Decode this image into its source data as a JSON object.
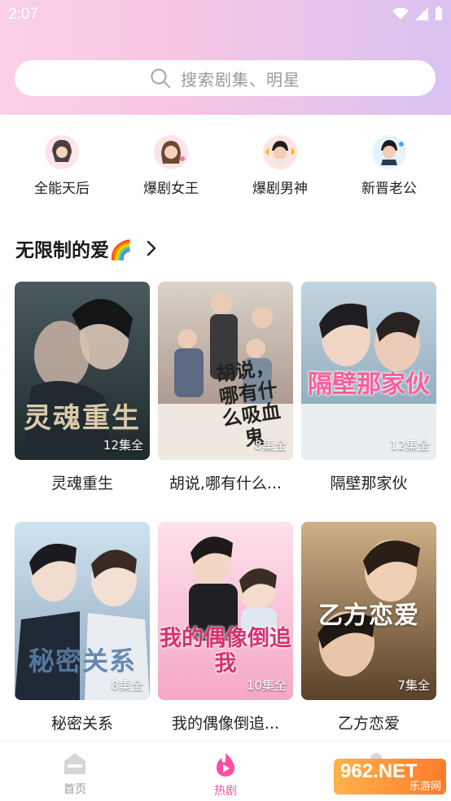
{
  "status": {
    "time": "2:07"
  },
  "search": {
    "placeholder": "搜索剧集、明星"
  },
  "categories": [
    {
      "label": "全能天后"
    },
    {
      "label": "爆剧女王"
    },
    {
      "label": "爆剧男神"
    },
    {
      "label": "新晋老公"
    }
  ],
  "section": {
    "title": "无限制的爱🌈"
  },
  "dramas": [
    {
      "title": "灵魂重生",
      "episodes": "12集全",
      "poster_text": "灵魂重生",
      "color_top": "#4a5a5e",
      "color_bottom": "#1e2a2c"
    },
    {
      "title": "胡说,哪有什么...",
      "episodes": "8集全",
      "poster_text": "胡说，哪有什么吸血鬼",
      "color_top": "#c9c2b8",
      "color_bottom": "#8b6f66"
    },
    {
      "title": "隔壁那家伙",
      "episodes": "12集全",
      "poster_text": "隔壁那家伙",
      "color_top": "#b4c8d8",
      "color_bottom": "#6e8fa8"
    },
    {
      "title": "秘密关系",
      "episodes": "8集全",
      "poster_text": "秘密关系",
      "color_top": "#c7dcec",
      "color_bottom": "#7f9bb5"
    },
    {
      "title": "我的偶像倒追...",
      "episodes": "10集全",
      "poster_text": "我的偶像倒追我",
      "color_top": "#fbd6e4",
      "color_bottom": "#f08fb5"
    },
    {
      "title": "乙方恋爱",
      "episodes": "7集全",
      "poster_text": "乙方恋爱",
      "color_top": "#c8a477",
      "color_bottom": "#6e4f2e"
    }
  ],
  "tabs": [
    {
      "label": "首页"
    },
    {
      "label": "热剧"
    }
  ],
  "watermark": {
    "brand": "962.NET",
    "sub": "乐游网"
  },
  "colors": {
    "accent": "#ff4fa0",
    "header_start": "#fbd0e6",
    "header_end": "#d9c2f1"
  }
}
